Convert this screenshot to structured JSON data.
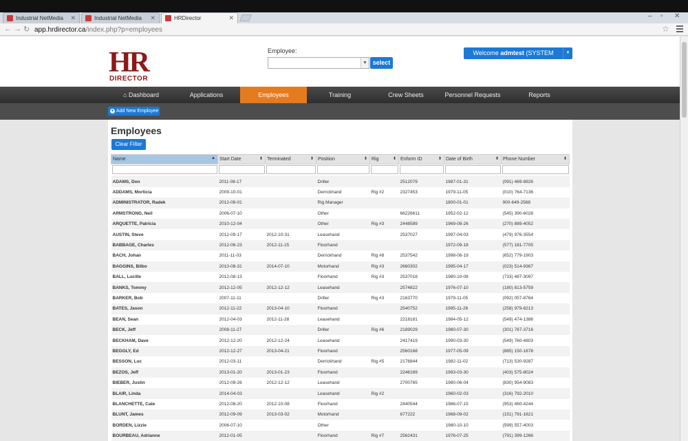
{
  "browser": {
    "tabs": [
      {
        "label": "Industrial NetMedia"
      },
      {
        "label": "Industrial NetMedia"
      },
      {
        "label": "HRDirector"
      }
    ],
    "url_host": "app.hrdirector.ca",
    "url_path": "/index.php?p=employees"
  },
  "header": {
    "logo_hr": "HR",
    "logo_sub": "DIRECTOR",
    "employee_label": "Employee:",
    "select_label": "select",
    "welcome_prefix": "Welcome",
    "welcome_user": "admtest",
    "welcome_role": "(SYSTEM ADMIN)"
  },
  "nav": {
    "items": [
      "Dashboard",
      "Applications",
      "Employees",
      "Training",
      "Crew Sheets",
      "Personnel Requests",
      "Reports"
    ],
    "active": "Employees"
  },
  "subnav": {
    "add_label": "Add New Employee"
  },
  "main": {
    "title": "Employees",
    "clear_filter": "Clear Filter",
    "columns": [
      "Name",
      "Start Date",
      "Terminated",
      "Position",
      "Rig",
      "Enform ID",
      "Date of Birth",
      "Phone Number"
    ],
    "rows": [
      [
        "ADAMS, Don",
        "2011-08-17",
        "",
        "Driller",
        "",
        "2512079",
        "1987-01-31",
        "(091) 469-8926"
      ],
      [
        "ADDAMS, Morticia",
        "2009-10-01",
        "",
        "Derrickhand",
        "Rig #2",
        "2327453",
        "1979-11-05",
        "(010) 764-7136"
      ],
      [
        "ADMINISTRATOR, Radek",
        "2012-08-01",
        "",
        "Rig Manager",
        "",
        "",
        "1800-01-01",
        "900-649-2568"
      ],
      [
        "ARMSTRONG, Neil",
        "2006-07-10",
        "",
        "Other",
        "",
        "66226611",
        "1952-02-12",
        "(545) 390-6028"
      ],
      [
        "ARQUETTE, Patricia",
        "2010-12-04",
        "",
        "Other",
        "Rig #3",
        "2448589",
        "1969-08-26",
        "(270) 889-4052"
      ],
      [
        "AUSTIN, Steve",
        "2012-09-17",
        "2012-10-31",
        "Leasehand",
        "",
        "2537027",
        "1997-04-03",
        "(479) 976-3554"
      ],
      [
        "BABBAGE, Charles",
        "2012-06-23",
        "2012-11-15",
        "Floorhand",
        "",
        "",
        "1972-09-18",
        "(577) 181-7705"
      ],
      [
        "BACH, Johan",
        "2011-11-03",
        "",
        "Derrickhand",
        "Rig #8",
        "2537542",
        "1998-06-19",
        "(652) 779-1903"
      ],
      [
        "BAGGINS, Bilbo",
        "2010-08-31",
        "2014-07-10",
        "Motorhand",
        "Rig #3",
        "2660302",
        "1995-04-17",
        "(023) 514-9367"
      ],
      [
        "BALL, Lucille",
        "2012-08-13",
        "",
        "Floorhand",
        "Rig #3",
        "2537018",
        "1980-10-08",
        "(733) 487-3097"
      ],
      [
        "BANKS, Tommy",
        "2012-12-05",
        "2012-12-12",
        "Leasehand",
        "",
        "2574822",
        "1976-07-10",
        "(180) 813-5759"
      ],
      [
        "BARKER, Bob",
        "2007-11-11",
        "",
        "Driller",
        "Rig #3",
        "2163770",
        "1979-11-05",
        "(092) 057-8764"
      ],
      [
        "BATES, Jason",
        "2012-11-22",
        "2013-04-10",
        "Floorhand",
        "",
        "2540752",
        "1995-11-26",
        "(258) 979-8213"
      ],
      [
        "BEAN, Sean",
        "2012-04-03",
        "2012-11-28",
        "Leasehand",
        "",
        "2218181",
        "1984-05-12",
        "(549) 474-1386"
      ],
      [
        "BECK, Jeff",
        "2008-11-27",
        "",
        "Driller",
        "Rig #6",
        "2189029",
        "1980-07-30",
        "(301) 787-3716"
      ],
      [
        "BECKHAM, Dave",
        "2012-12-20",
        "2012-12-24",
        "Leasehand",
        "",
        "2417419",
        "1990-03-30",
        "(549) 760-4803"
      ],
      [
        "BEGGLY, Ed",
        "2012-12-27",
        "2013-04-21",
        "Floorhand",
        "",
        "2560168",
        "1977-05-09",
        "(885) 150-1678"
      ],
      [
        "BESSON, Luc",
        "2012-03-11",
        "",
        "Derrickhand",
        "Rig #5",
        "2176844",
        "1982-11-02",
        "(713) 530-9287"
      ],
      [
        "BEZOS, Jeff",
        "2013-01-20",
        "2013-01-23",
        "Floorhand",
        "",
        "2246169",
        "1993-03-30",
        "(403) 575-8024"
      ],
      [
        "BIEBER, Justin",
        "2012-09-26",
        "2012-12-12",
        "Leasehand",
        "",
        "2700765",
        "1980-06-04",
        "(830) 954-9083"
      ],
      [
        "BLAIR, Linda",
        "2014-04-03",
        "",
        "Leasehand",
        "Rig #2",
        "",
        "1960-02-03",
        "(316) 792-2010"
      ],
      [
        "BLANCHETTE, Cate",
        "2012-08-20",
        "2012-10-08",
        "Floorhand",
        "",
        "2440544",
        "1986-07-15",
        "(953) 460-4244"
      ],
      [
        "BLUNT, James",
        "2012-09-09",
        "2013-03-02",
        "Motorhand",
        "",
        "677222",
        "1968-09-02",
        "(151) 791-1621"
      ],
      [
        "BORDEN, Lizzie",
        "2006-07-10",
        "",
        "Other",
        "",
        "",
        "1980-10-10",
        "(599) 557-4003"
      ],
      [
        "BOURBEAU, Adrianne",
        "2012-01-05",
        "",
        "Floorhand",
        "Rig #7",
        "2562431",
        "1976-07-25",
        "(791) 399-1266"
      ]
    ]
  }
}
